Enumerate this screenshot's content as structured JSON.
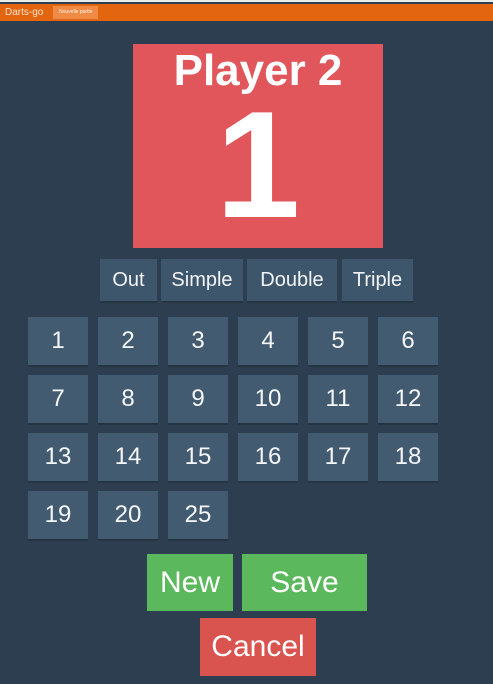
{
  "app": {
    "title": "Darts-go",
    "nav_tab": "Nouvelle partie"
  },
  "player": {
    "name": "Player 2",
    "score": "1"
  },
  "modifiers": [
    "Out",
    "Simple",
    "Double",
    "Triple"
  ],
  "numbers": [
    "1",
    "2",
    "3",
    "4",
    "5",
    "6",
    "7",
    "8",
    "9",
    "10",
    "11",
    "12",
    "13",
    "14",
    "15",
    "16",
    "17",
    "18",
    "19",
    "20",
    "25"
  ],
  "actions": {
    "new_label": "New",
    "save_label": "Save",
    "cancel_label": "Cancel"
  },
  "colors": {
    "background": "#2c3e50",
    "topbar": "#e3650f",
    "player_box": "#e0565b",
    "button": "#435b70",
    "success": "#5cb85c",
    "danger": "#d9534f"
  }
}
